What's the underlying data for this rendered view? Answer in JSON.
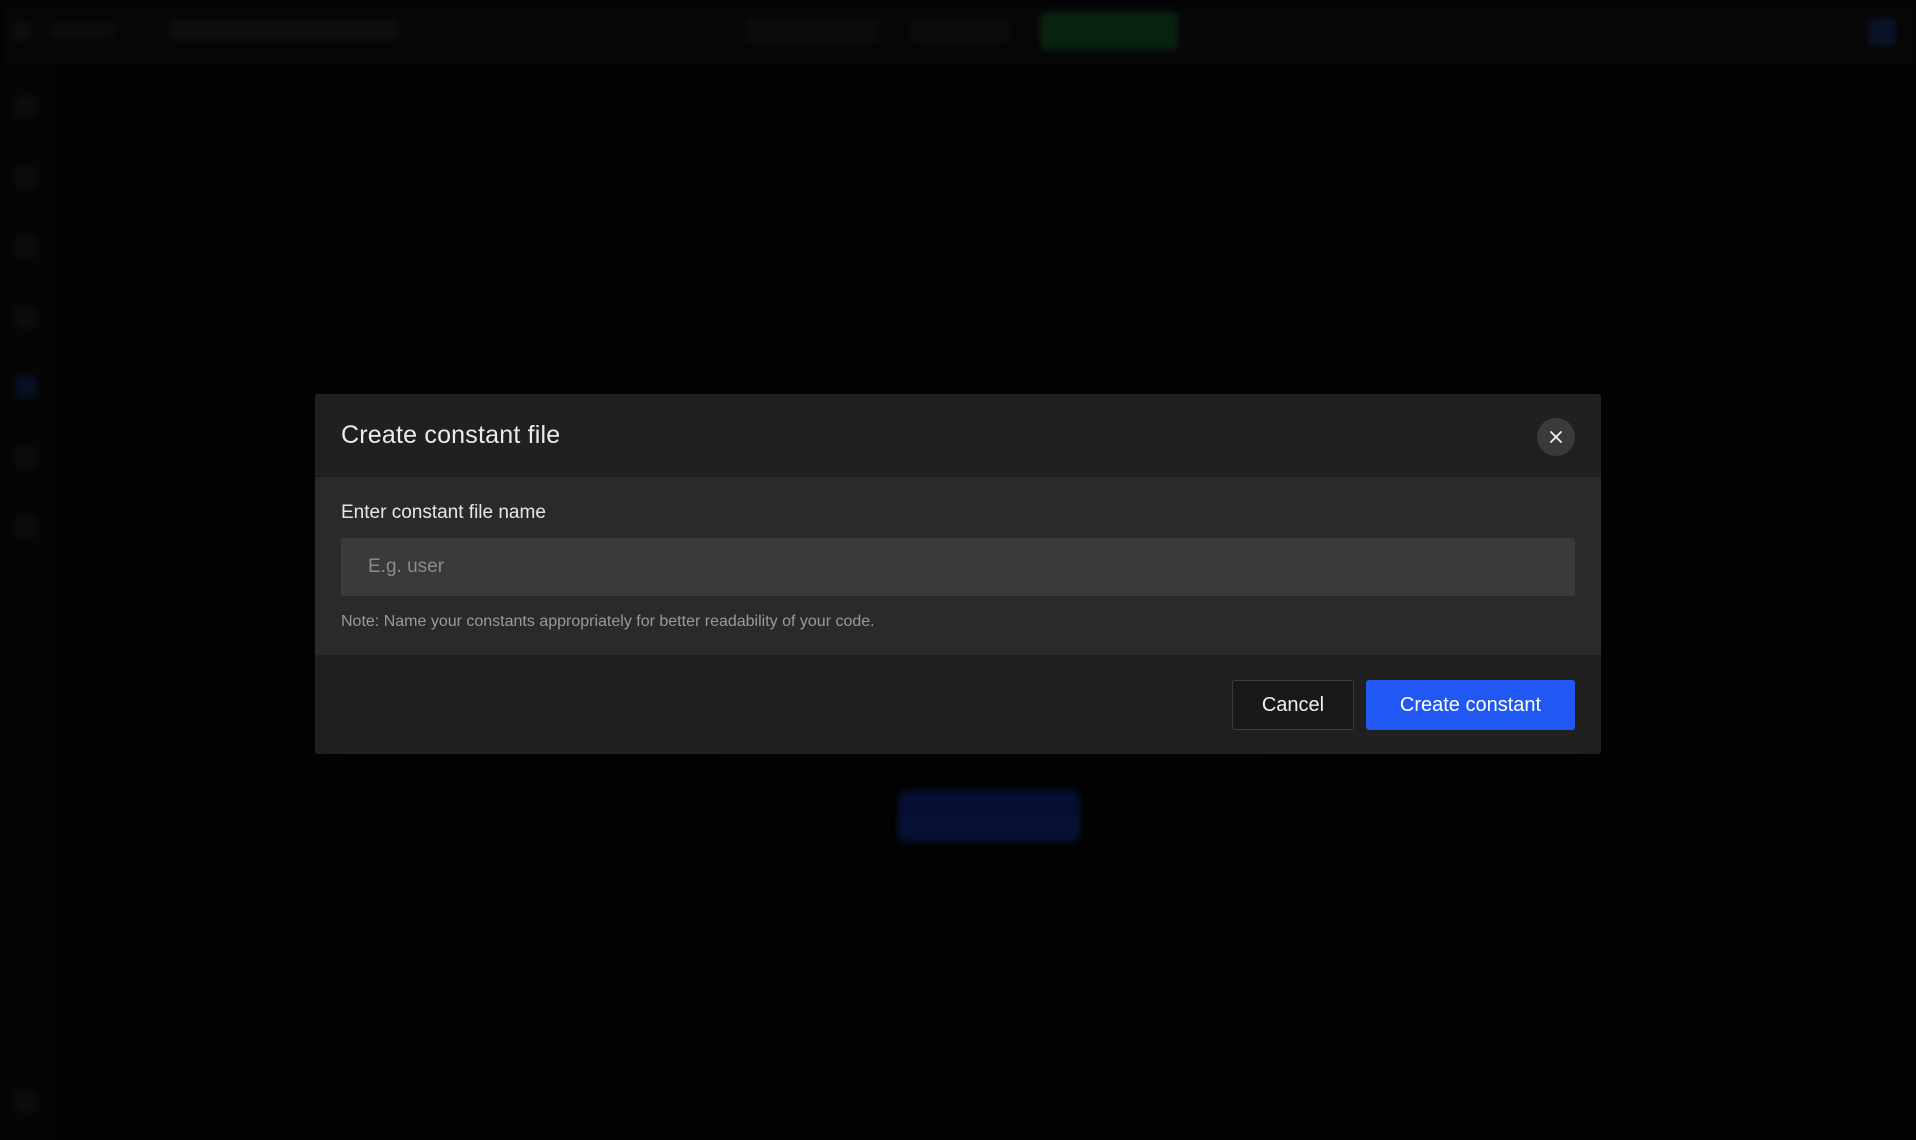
{
  "background": {
    "accent_green": "#123d1c",
    "accent_blue": "#2157f3"
  },
  "modal": {
    "title": "Create constant file",
    "close_icon": "close-icon",
    "field_label": "Enter constant file name",
    "input": {
      "value": "",
      "placeholder": "E.g. user"
    },
    "note": "Note: Name your constants appropriately for better readability of your code.",
    "cancel_label": "Cancel",
    "create_label": "Create constant"
  }
}
